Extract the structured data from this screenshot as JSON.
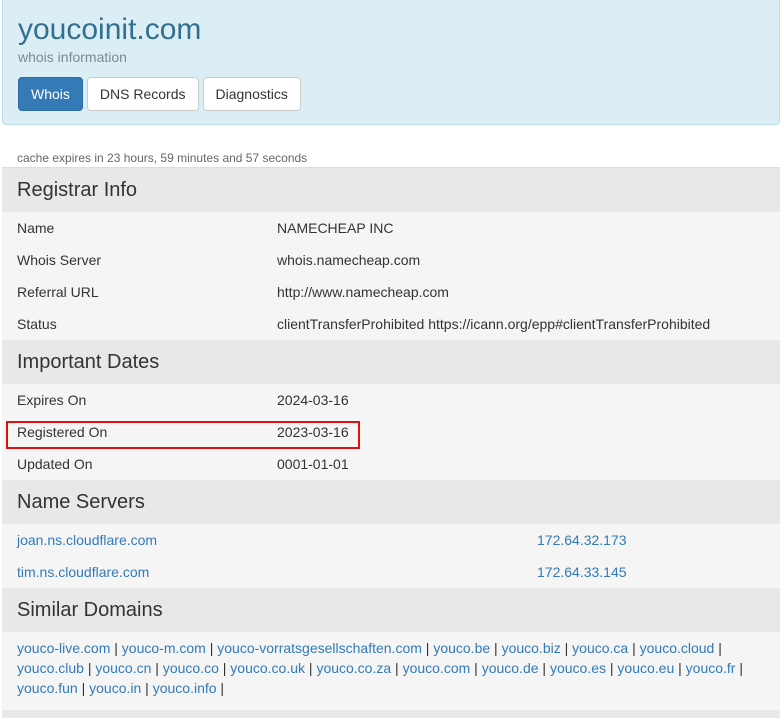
{
  "header": {
    "title": "youcoinit.com",
    "subtitle": "whois information",
    "tabs": [
      {
        "label": "Whois",
        "active": true
      },
      {
        "label": "DNS Records",
        "active": false
      },
      {
        "label": "Diagnostics",
        "active": false
      }
    ]
  },
  "cache_note": "cache expires in 23 hours, 59 minutes and 57 seconds",
  "registrar": {
    "heading": "Registrar Info",
    "rows": [
      {
        "key": "Name",
        "value": "NAMECHEAP INC"
      },
      {
        "key": "Whois Server",
        "value": "whois.namecheap.com"
      },
      {
        "key": "Referral URL",
        "value": "http://www.namecheap.com"
      },
      {
        "key": "Status",
        "value": "clientTransferProhibited https://icann.org/epp#clientTransferProhibited"
      }
    ]
  },
  "dates": {
    "heading": "Important Dates",
    "rows": [
      {
        "key": "Expires On",
        "value": "2024-03-16"
      },
      {
        "key": "Registered On",
        "value": "2023-03-16"
      },
      {
        "key": "Updated On",
        "value": "0001-01-01"
      }
    ]
  },
  "nameservers": {
    "heading": "Name Servers",
    "rows": [
      {
        "host": "joan.ns.cloudflare.com",
        "ip": "172.64.32.173"
      },
      {
        "host": "tim.ns.cloudflare.com",
        "ip": "172.64.33.145"
      }
    ]
  },
  "similar": {
    "heading": "Similar Domains",
    "domains": [
      "youco-live.com",
      "youco-m.com",
      "youco-vorratsgesellschaften.com",
      "youco.be",
      "youco.biz",
      "youco.ca",
      "youco.cloud",
      "youco.club",
      "youco.cn",
      "youco.co",
      "youco.co.uk",
      "youco.co.za",
      "youco.com",
      "youco.de",
      "youco.es",
      "youco.eu",
      "youco.fr",
      "youco.fun",
      "youco.in",
      "youco.info"
    ],
    "separator": "|"
  },
  "colors": {
    "header_bg": "#dbeef6",
    "title": "#31708f",
    "active_tab": "#337ab7",
    "link": "#337ab7",
    "highlight": "#e01010"
  }
}
